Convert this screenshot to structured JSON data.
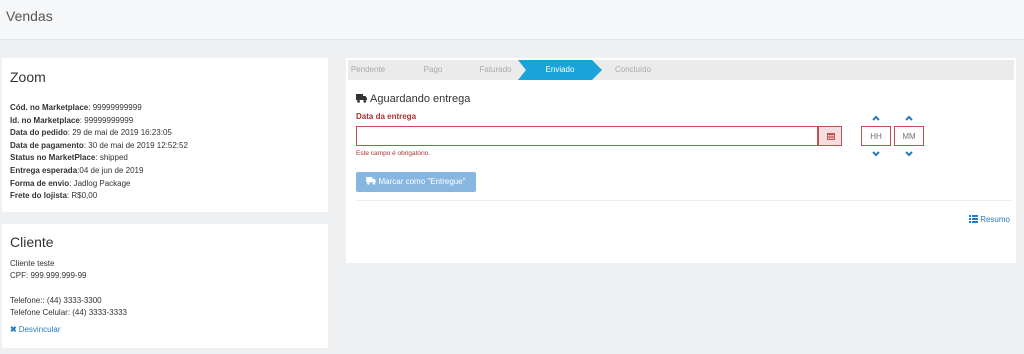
{
  "header": {
    "title": "Vendas"
  },
  "zoom": {
    "title": "Zoom",
    "rows": [
      {
        "label": "Cód. no Marketplace",
        "sep": ": ",
        "value": "99999999999"
      },
      {
        "label": "Id. no Marketplace",
        "sep": ": ",
        "value": "99999999999"
      },
      {
        "label": "Data do pedido",
        "sep": ": ",
        "value": "29 de mai de 2019 16:23:05"
      },
      {
        "label": "Data de pagamento",
        "sep": ": ",
        "value": "30 de mai de 2019 12:52:52"
      },
      {
        "label": "Status no MarketPlace",
        "sep": ": ",
        "value": "shipped"
      },
      {
        "label": "Entrega esperada",
        "sep": ":",
        "value": "04 de jun de 2019"
      },
      {
        "label": "Forma de envio",
        "sep": ": ",
        "value": "Jadlog Package"
      },
      {
        "label": "Frete do lojista",
        "sep": ": ",
        "value": "R$0,00"
      }
    ]
  },
  "cliente": {
    "title": "Cliente",
    "name": "Cliente teste",
    "cpf": "CPF: 999.999.999-99",
    "phone": "Telefone:: (44) 3333-3300",
    "mobile": "Telefone Celular: (44) 3333-3333",
    "unlink": "Desvincular"
  },
  "steps": [
    "Pendente",
    "Pago",
    "Faturado",
    "Enviado",
    "Concluído"
  ],
  "step_active": "Enviado",
  "delivery": {
    "status": "Aguardando entrega",
    "date_label": "Data da entrega",
    "date_value": "",
    "error": "Este campo é obrigatório.",
    "hour_placeholder": "HH",
    "minute_placeholder": "MM",
    "mark_button": "Marcar como \"Entregue\"",
    "summary_link": "Resumo"
  },
  "colors": {
    "accent": "#1aa3d9",
    "error": "#b03030",
    "link": "#2a7ab8",
    "button": "#87b7e0"
  }
}
